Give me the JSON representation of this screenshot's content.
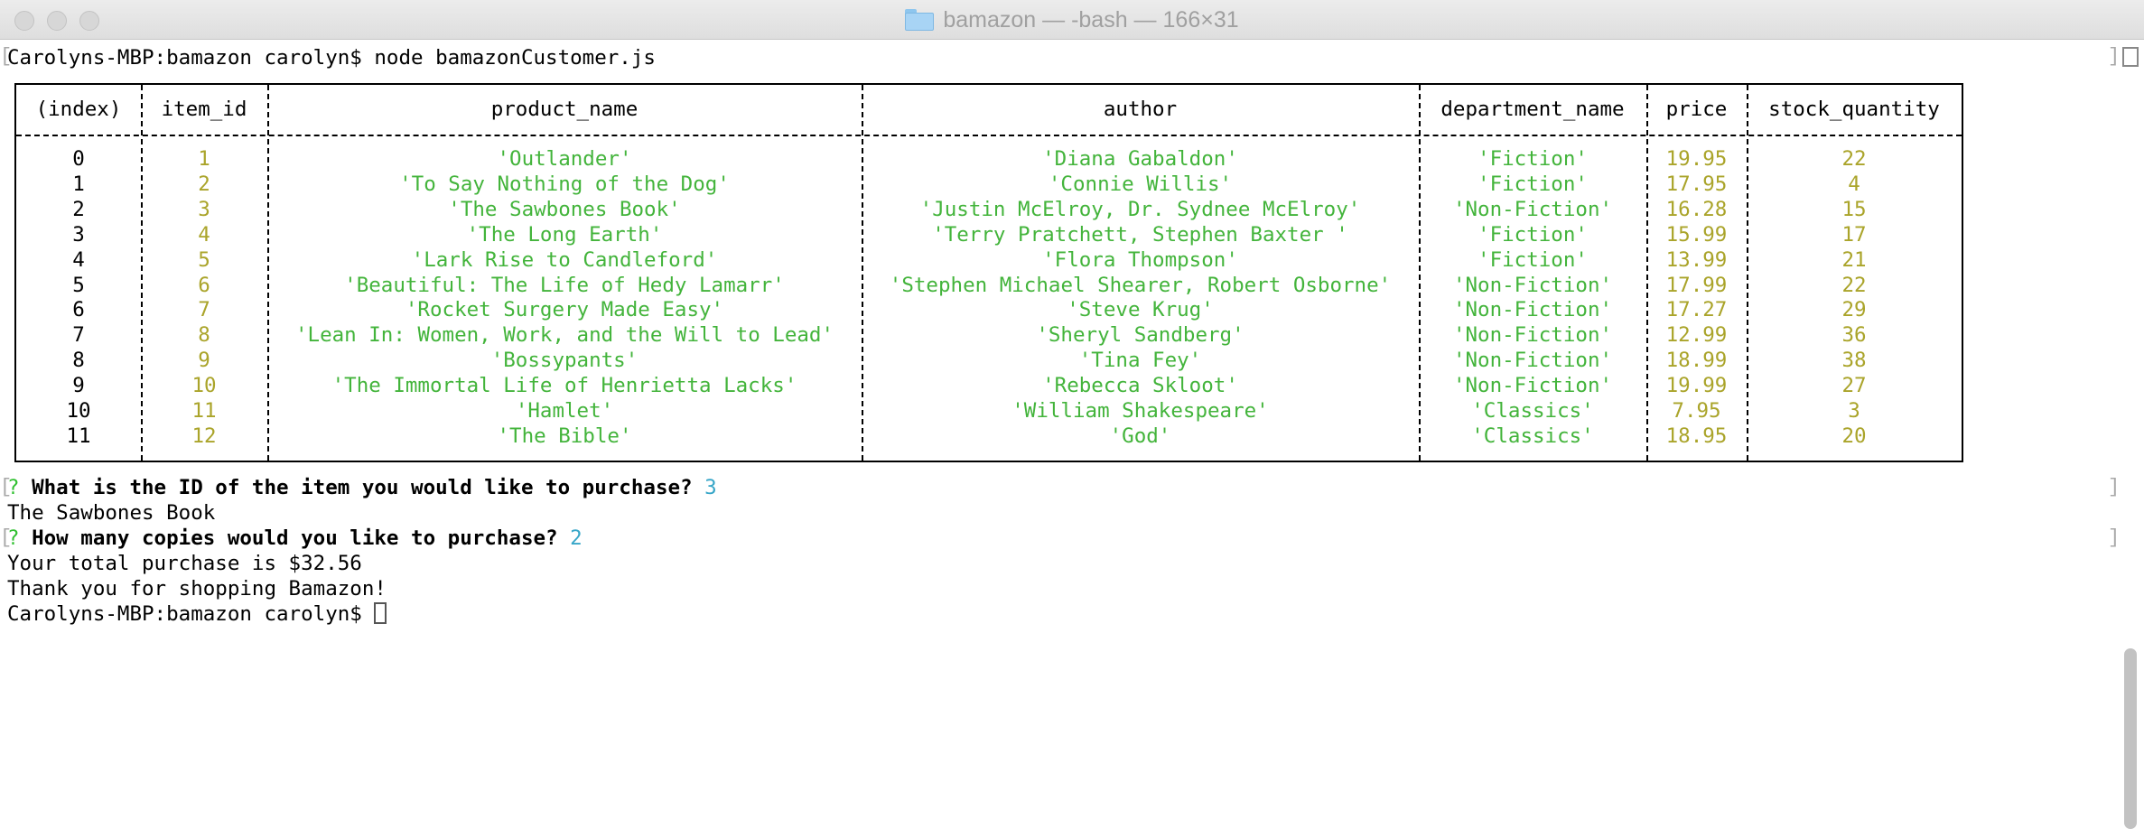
{
  "window": {
    "title": "bamazon — -bash — 166×31"
  },
  "terminal": {
    "command_line": "Carolyns-MBP:bamazon carolyn$ node bamazonCustomer.js",
    "prompt_mark": "?",
    "question1": "What is the ID of the item you would like to purchase?",
    "answer1": "3",
    "selected_item": "The Sawbones Book",
    "question2": "How many copies would you like to purchase?",
    "answer2": "2",
    "total_line": "Your total purchase is $32.56",
    "thanks_line": "Thank you for shopping Bamazon!",
    "final_prompt": "Carolyns-MBP:bamazon carolyn$ "
  },
  "table": {
    "headers": [
      "(index)",
      "item_id",
      "product_name",
      "author",
      "department_name",
      "price",
      "stock_quantity"
    ],
    "rows": [
      [
        "0",
        "1",
        "'Outlander'",
        "'Diana Gabaldon'",
        "'Fiction'",
        "19.95",
        "22"
      ],
      [
        "1",
        "2",
        "'To Say Nothing of the Dog'",
        "'Connie Willis'",
        "'Fiction'",
        "17.95",
        "4"
      ],
      [
        "2",
        "3",
        "'The Sawbones Book'",
        "'Justin McElroy, Dr. Sydnee McElroy'",
        "'Non-Fiction'",
        "16.28",
        "15"
      ],
      [
        "3",
        "4",
        "'The Long Earth'",
        "'Terry Pratchett, Stephen Baxter '",
        "'Fiction'",
        "15.99",
        "17"
      ],
      [
        "4",
        "5",
        "'Lark Rise to Candleford'",
        "'Flora Thompson'",
        "'Fiction'",
        "13.99",
        "21"
      ],
      [
        "5",
        "6",
        "'Beautiful: The Life of Hedy Lamarr'",
        "'Stephen Michael Shearer, Robert Osborne'",
        "'Non-Fiction'",
        "17.99",
        "22"
      ],
      [
        "6",
        "7",
        "'Rocket Surgery Made Easy'",
        "'Steve Krug'",
        "'Non-Fiction'",
        "17.27",
        "29"
      ],
      [
        "7",
        "8",
        "'Lean In: Women, Work, and the Will to Lead'",
        "'Sheryl Sandberg'",
        "'Non-Fiction'",
        "12.99",
        "36"
      ],
      [
        "8",
        "9",
        "'Bossypants'",
        "'Tina Fey'",
        "'Non-Fiction'",
        "18.99",
        "38"
      ],
      [
        "9",
        "10",
        "'The Immortal Life of Henrietta Lacks'",
        "'Rebecca Skloot'",
        "'Non-Fiction'",
        "19.99",
        "27"
      ],
      [
        "10",
        "11",
        "'Hamlet'",
        "'William Shakespeare'",
        "'Classics'",
        "7.95",
        "3"
      ],
      [
        "11",
        "12",
        "'The Bible'",
        "'God'",
        "'Classics'",
        "18.95",
        "20"
      ]
    ]
  },
  "colors": {
    "index_text": "#000000",
    "number_text": "#aaa42a",
    "string_text": "#43b43b",
    "answer_text": "#37a6c8"
  }
}
